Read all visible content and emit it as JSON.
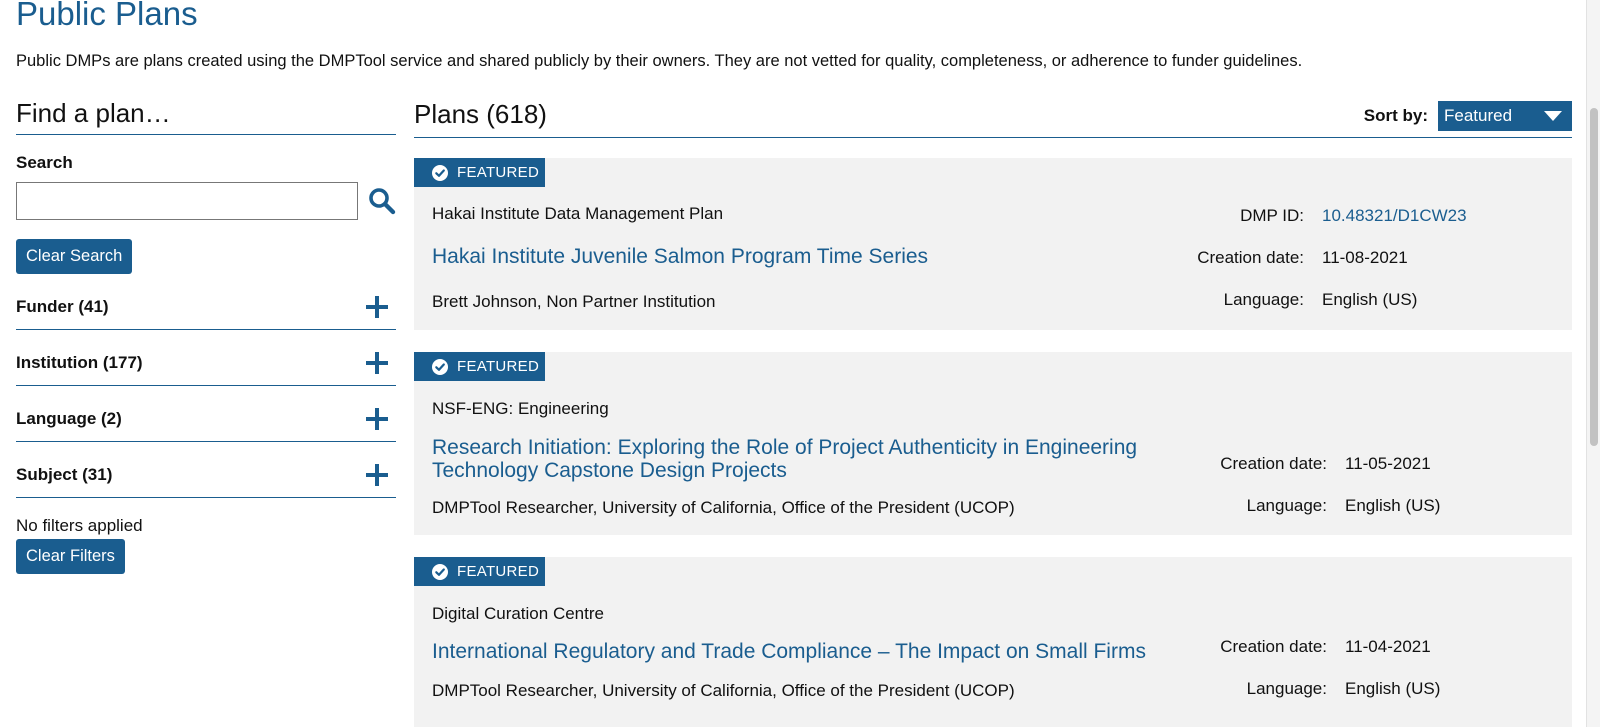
{
  "page": {
    "title": "Public Plans",
    "intro": "Public DMPs are plans created using the DMPTool service and shared publicly by their owners. They are not vetted for quality, completeness, or adherence to funder guidelines."
  },
  "sidebar": {
    "title": "Find a plan…",
    "search_label": "Search",
    "search_value": "",
    "search_icon": "search-icon",
    "clear_search_label": "Clear Search",
    "facets": [
      {
        "label": "Funder (41)"
      },
      {
        "label": "Institution (177)"
      },
      {
        "label": "Language (2)"
      },
      {
        "label": "Subject (31)"
      }
    ],
    "no_filters_text": "No filters applied",
    "clear_filters_label": "Clear Filters"
  },
  "main": {
    "plans_title": "Plans (618)",
    "sort_label": "Sort by:",
    "sort_value": "Featured"
  },
  "plans": [
    {
      "badge": "FEATURED",
      "funder": "Hakai Institute Data Management Plan",
      "title": "Hakai Institute Juvenile Salmon Program Time Series",
      "owner": "Brett Johnson, Non Partner Institution",
      "dmp_id_label": "DMP ID:",
      "dmp_id": "10.48321/D1CW23",
      "creation_label": "Creation date:",
      "creation_date": "11-08-2021",
      "language_label": "Language:",
      "language": "English (US)"
    },
    {
      "badge": "FEATURED",
      "funder": "NSF-ENG: Engineering",
      "title_line1": "Research Initiation: Exploring the Role of Project Authenticity in Engineering",
      "title_line2": "Technology Capstone Design Projects",
      "owner": "DMPTool Researcher, University of California, Office of the President (UCOP)",
      "creation_label": "Creation date:",
      "creation_date": "11-05-2021",
      "language_label": "Language:",
      "language": "English (US)"
    },
    {
      "badge": "FEATURED",
      "funder": "Digital Curation Centre",
      "title": "International Regulatory and Trade Compliance – The Impact on Small Firms",
      "owner": "DMPTool Researcher, University of California, Office of the President (UCOP)",
      "creation_label": "Creation date:",
      "creation_date": "11-04-2021",
      "language_label": "Language:",
      "language": "English (US)"
    }
  ],
  "colors": {
    "brand": "#1a5d8f",
    "card_bg": "#f2f2f2"
  }
}
